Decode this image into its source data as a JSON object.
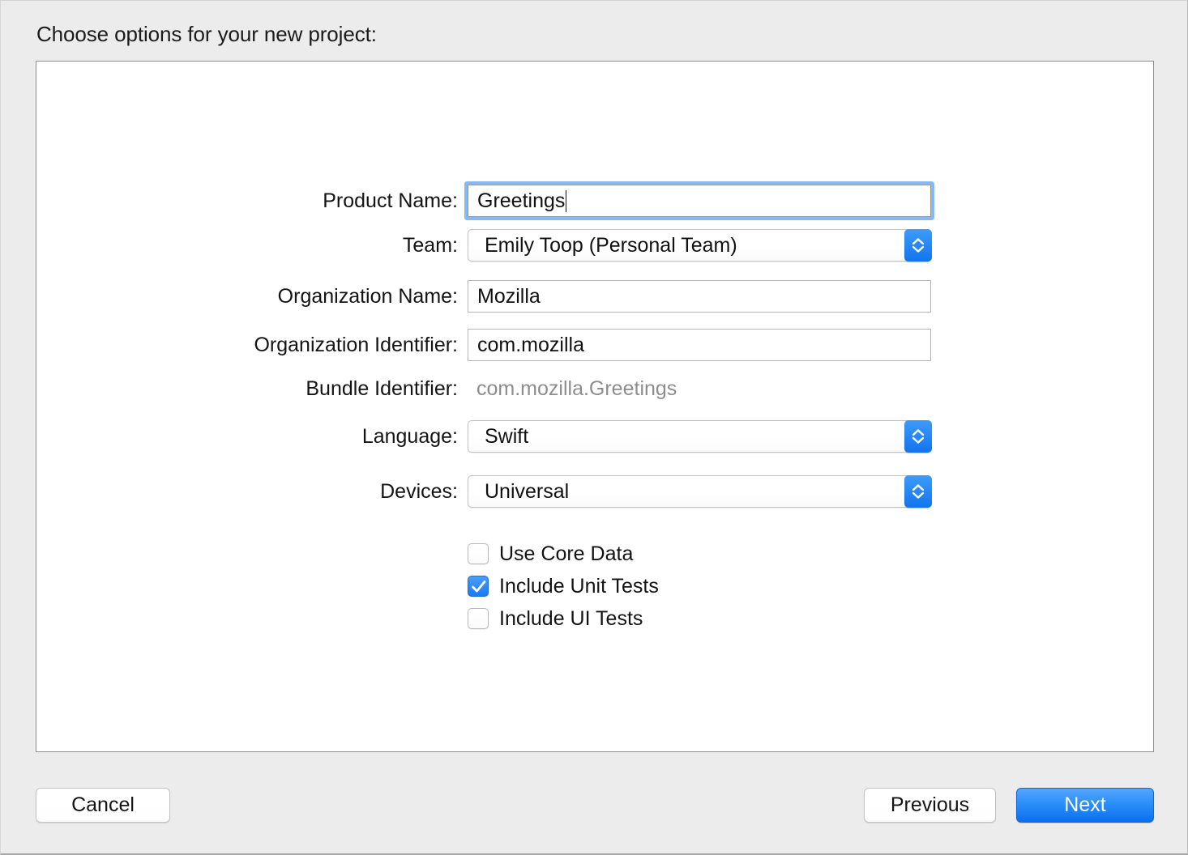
{
  "dialog": {
    "heading": "Choose options for your new project:"
  },
  "form": {
    "rows": [
      {
        "label": "Product Name:",
        "value": "Greetings",
        "type": "textfield-focused"
      },
      {
        "label": "Team:",
        "value": "Emily Toop (Personal Team)",
        "type": "popup"
      },
      {
        "label": "Organization Name:",
        "value": "Mozilla",
        "type": "textfield"
      },
      {
        "label": "Organization Identifier:",
        "value": "com.mozilla",
        "type": "textfield"
      },
      {
        "label": "Bundle Identifier:",
        "value": "com.mozilla.Greetings",
        "type": "static"
      },
      {
        "label": "Language:",
        "value": "Swift",
        "type": "popup"
      },
      {
        "label": "Devices:",
        "value": "Universal",
        "type": "popup"
      }
    ],
    "checkboxes": [
      {
        "label": "Use Core Data",
        "checked": false
      },
      {
        "label": "Include Unit Tests",
        "checked": true
      },
      {
        "label": "Include UI Tests",
        "checked": false
      }
    ]
  },
  "buttons": {
    "cancel": "Cancel",
    "previous": "Previous",
    "next": "Next"
  },
  "colors": {
    "window_background": "#ececec",
    "panel_background": "#ffffff",
    "panel_border": "#8e8e8e",
    "accent_blue": "#1274f0",
    "focus_ring": "#86b9f2",
    "primary_button": "#2c8ffa",
    "disabled_text": "#8d8d8d",
    "text": "#141414"
  }
}
